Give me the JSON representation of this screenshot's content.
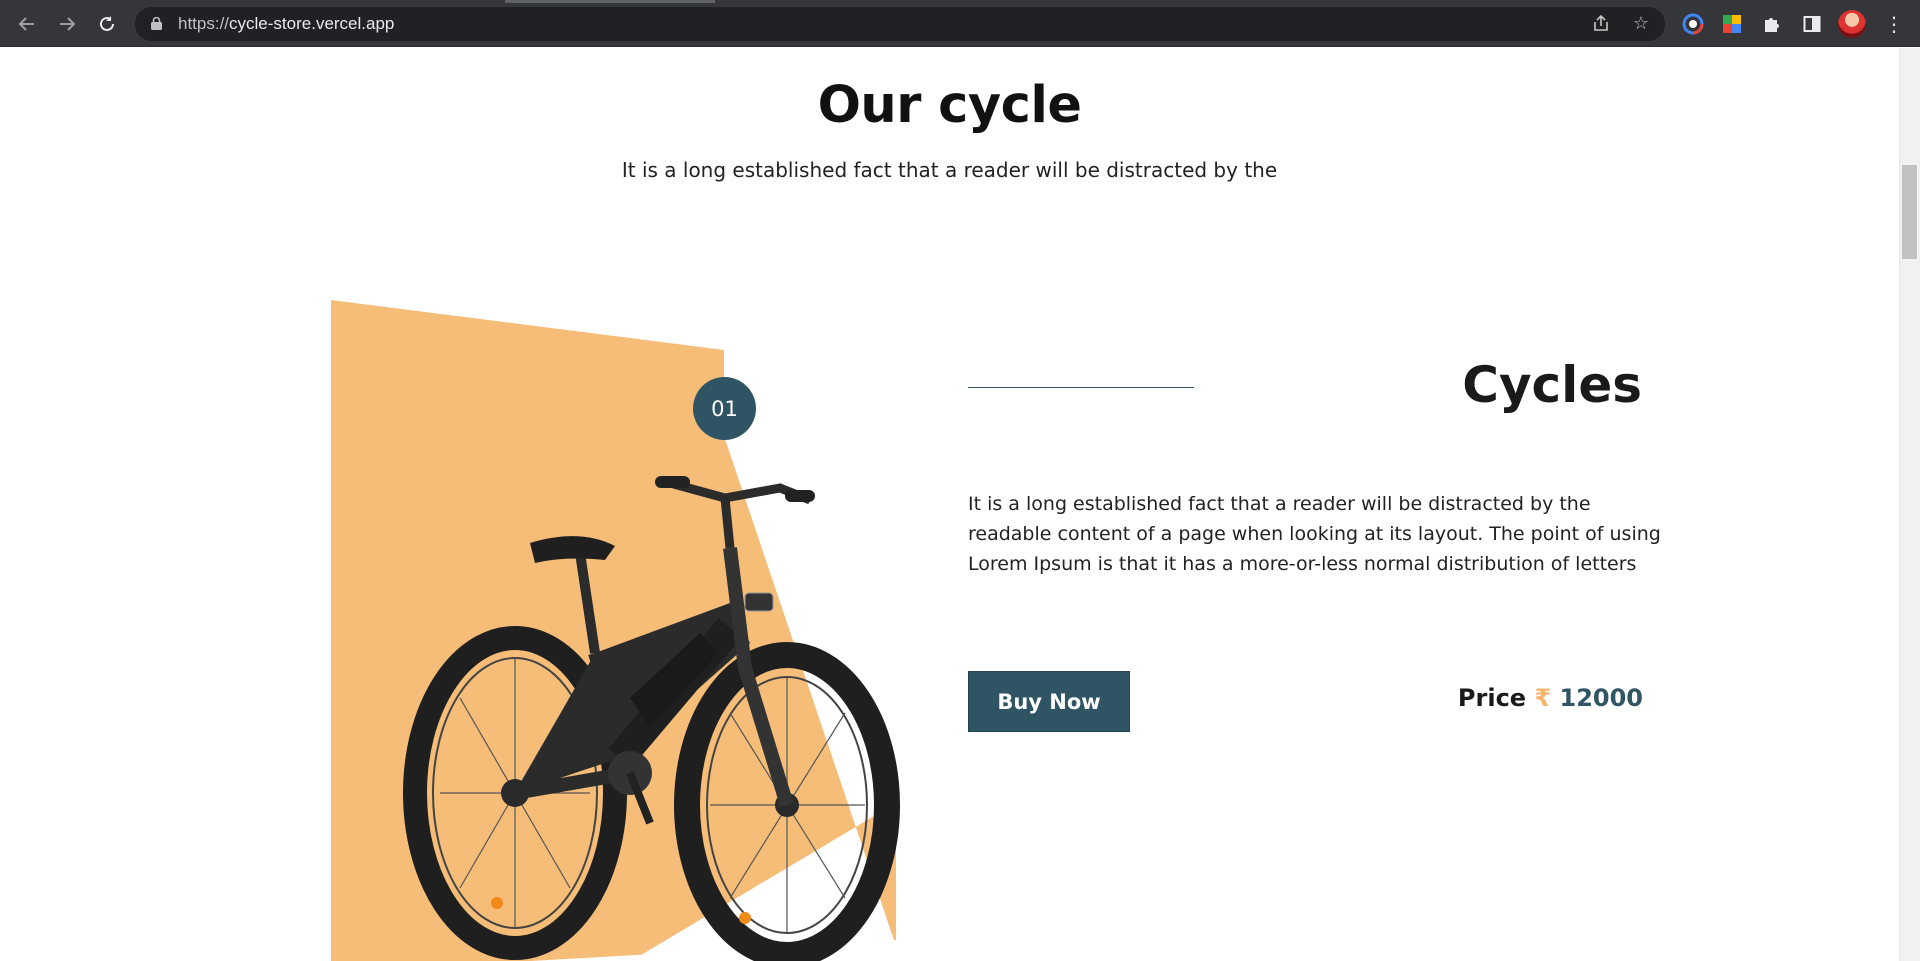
{
  "browser": {
    "url_scheme": "https://",
    "url_host": "cycle-store.vercel.app",
    "icons": [
      "back-icon",
      "forward-icon",
      "reload-icon",
      "lock-icon",
      "share-icon",
      "bookmark-star-icon",
      "color-picker-extension-icon",
      "extension-icon",
      "puzzle-extensions-icon",
      "side-panel-icon",
      "profile-avatar",
      "more-menu-icon"
    ]
  },
  "section": {
    "title": "Our cycle",
    "subtitle": "It is a long established fact that a reader will be distracted by the"
  },
  "product": {
    "index": "01",
    "title": "Cycles",
    "description": "It is a long established fact that a reader will be distracted by the readable content of a page when looking at its layout. The point of using Lorem Ipsum is that it has a more-or-less normal distribution of letters",
    "buy_label": "Buy Now",
    "price_label": "Price",
    "currency": "₹",
    "price": "12000"
  },
  "colors": {
    "accent": "#2f5564",
    "orange": "#f5bd78",
    "currency": "#f5b56b"
  }
}
